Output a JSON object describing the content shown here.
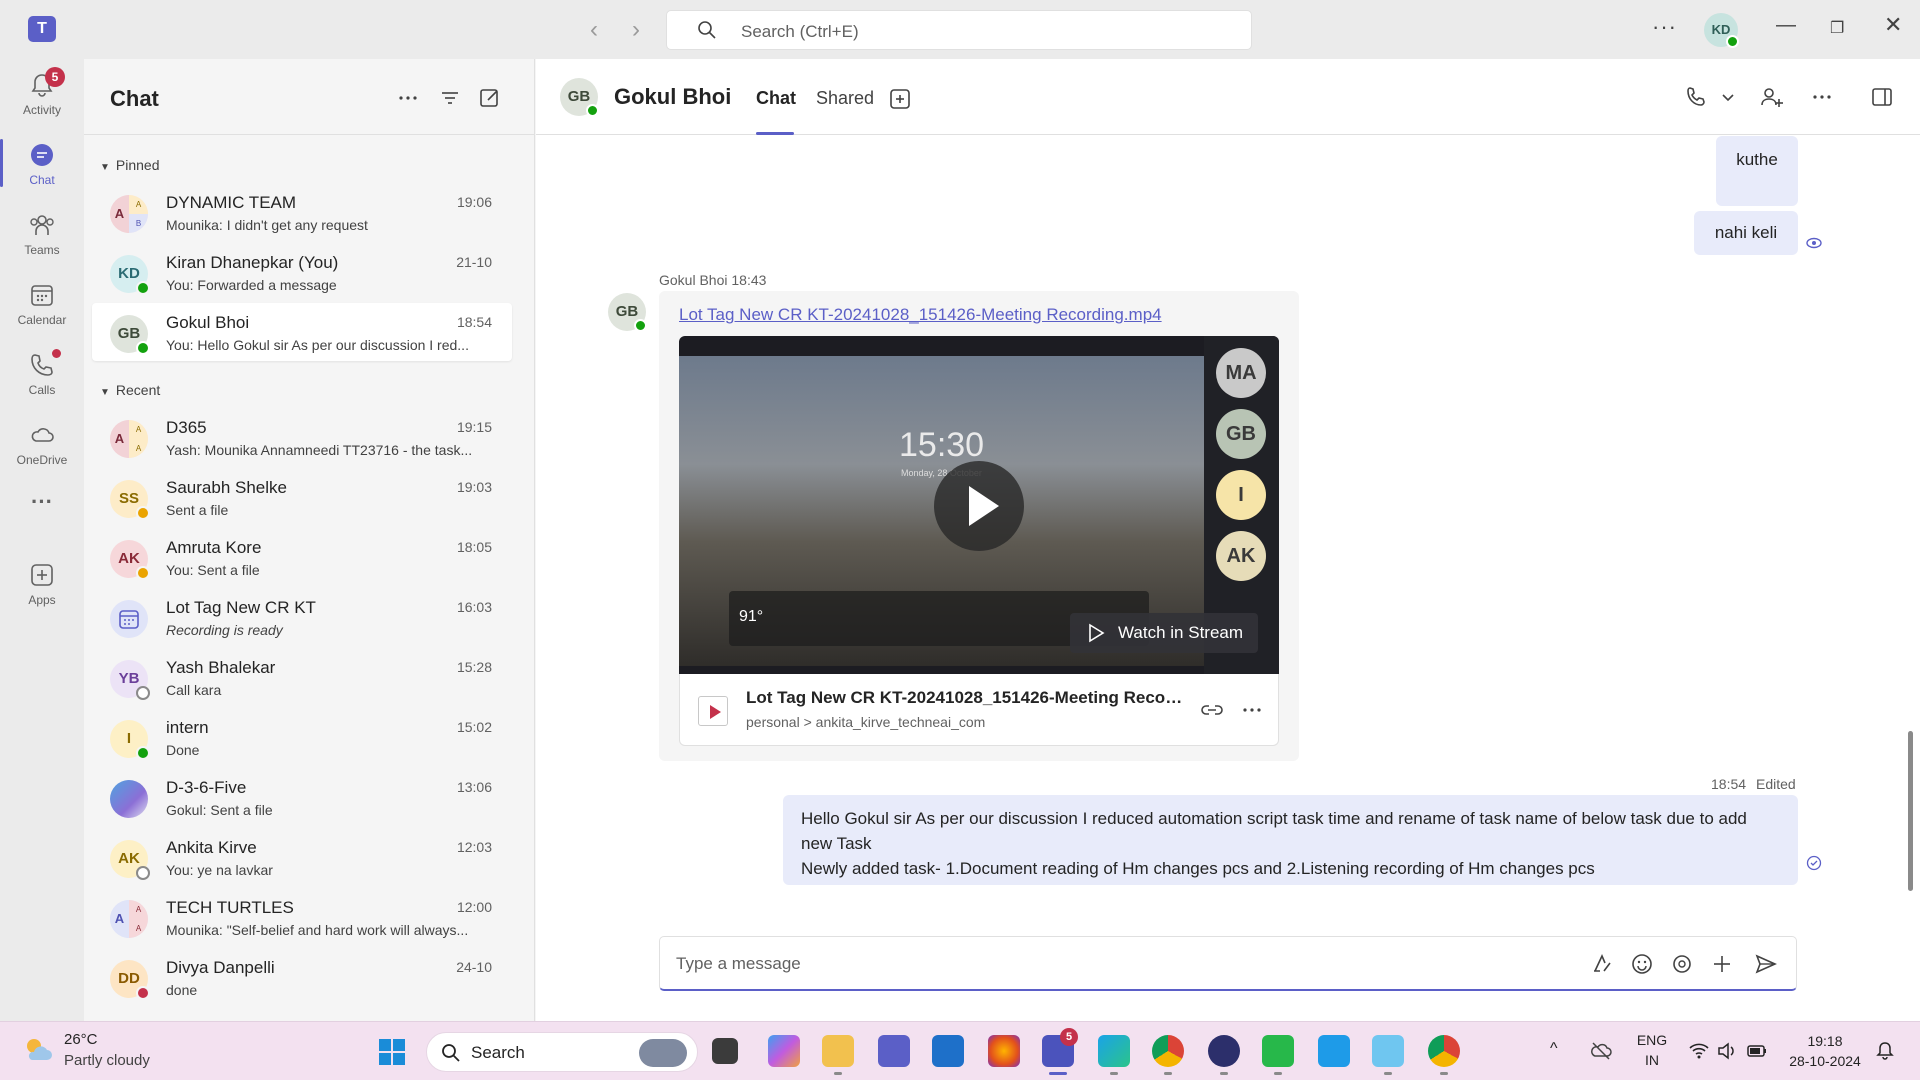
{
  "titlebar": {
    "search_placeholder": "Search (Ctrl+E)",
    "more": "···",
    "user_initials": "KD"
  },
  "rail": {
    "items": [
      {
        "label": "Activity",
        "badge": "5"
      },
      {
        "label": "Chat"
      },
      {
        "label": "Teams"
      },
      {
        "label": "Calendar"
      },
      {
        "label": "Calls"
      },
      {
        "label": "OneDrive"
      },
      {
        "label": "···"
      },
      {
        "label": "Apps"
      }
    ]
  },
  "chatlist": {
    "title": "Chat",
    "pinned_label": "Pinned",
    "recent_label": "Recent",
    "pinned": [
      {
        "initials": "A",
        "name": "DYNAMIC TEAM",
        "time": "19:06",
        "preview": "Mounika: I didn't get any request"
      },
      {
        "initials": "KD",
        "name": "Kiran Dhanepkar (You)",
        "time": "21-10",
        "preview": "You: Forwarded a message"
      },
      {
        "initials": "GB",
        "name": "Gokul Bhoi",
        "time": "18:54",
        "preview": "You: Hello Gokul sir As per our discussion I red..."
      }
    ],
    "recent": [
      {
        "initials": "A",
        "name": "D365",
        "time": "19:15",
        "preview": "Yash: Mounika Annamneedi  TT23716 - the task..."
      },
      {
        "initials": "SS",
        "name": "Saurabh Shelke",
        "time": "19:03",
        "preview": "Sent a file"
      },
      {
        "initials": "AK",
        "name": "Amruta Kore",
        "time": "18:05",
        "preview": "You: Sent a file"
      },
      {
        "initials": "",
        "name": "Lot Tag New CR KT",
        "time": "16:03",
        "preview": "Recording is ready"
      },
      {
        "initials": "YB",
        "name": "Yash Bhalekar",
        "time": "15:28",
        "preview": "Call kara"
      },
      {
        "initials": "I",
        "name": "intern",
        "time": "15:02",
        "preview": "Done"
      },
      {
        "initials": "",
        "name": "D-3-6-Five",
        "time": "13:06",
        "preview": "Gokul: Sent a file"
      },
      {
        "initials": "AK",
        "name": "Ankita Kirve",
        "time": "12:03",
        "preview": "You: ye na lavkar"
      },
      {
        "initials": "A",
        "name": "TECH TURTLES",
        "time": "12:00",
        "preview": "Mounika: \"Self-belief and hard work will always..."
      },
      {
        "initials": "DD",
        "name": "Divya Danpelli",
        "time": "24-10",
        "preview": "done"
      }
    ]
  },
  "conversation": {
    "initials": "GB",
    "name": "Gokul Bhoi",
    "tab_chat": "Chat",
    "tab_shared": "Shared",
    "my_msg_1": "kuthe",
    "my_msg_2": "nahi keli",
    "sender_line": "Gokul Bhoi  18:43",
    "link_text": "Lot Tag New CR KT-20241028_151426-Meeting Recording.mp4",
    "video_clock": "15:30",
    "video_date": "Monday, 28 October",
    "video_temp": "91°",
    "video_avatars": [
      "MA",
      "GB",
      "I",
      "AK"
    ],
    "watch_label": "Watch in Stream",
    "file_title": "Lot Tag New CR KT-20241028_151426-Meeting Record...",
    "file_path": "personal > ankita_kirve_techneai_com",
    "last_meta_time": "18:54",
    "last_meta_edited": "Edited",
    "last_msg_line1": "Hello Gokul sir As per our discussion I reduced automation script task time and rename of task name of below task due to add new Task",
    "last_msg_line2": "Newly added task- 1.Document reading of Hm changes pcs and 2.Listening recording of Hm changes pcs",
    "compose_placeholder": "Type a message"
  },
  "taskbar": {
    "temp": "26°C",
    "weather": "Partly cloudy",
    "search_label": "Search",
    "teams_badge": "5",
    "lang_top": "ENG",
    "lang_bottom": "IN",
    "time": "19:18",
    "date": "28-10-2024"
  },
  "colors": {
    "accent": "#5b5fc7",
    "my_bubble": "#e8ebfa",
    "online": "#13a10e",
    "away": "#eaa300",
    "busy": "#c4314b"
  }
}
